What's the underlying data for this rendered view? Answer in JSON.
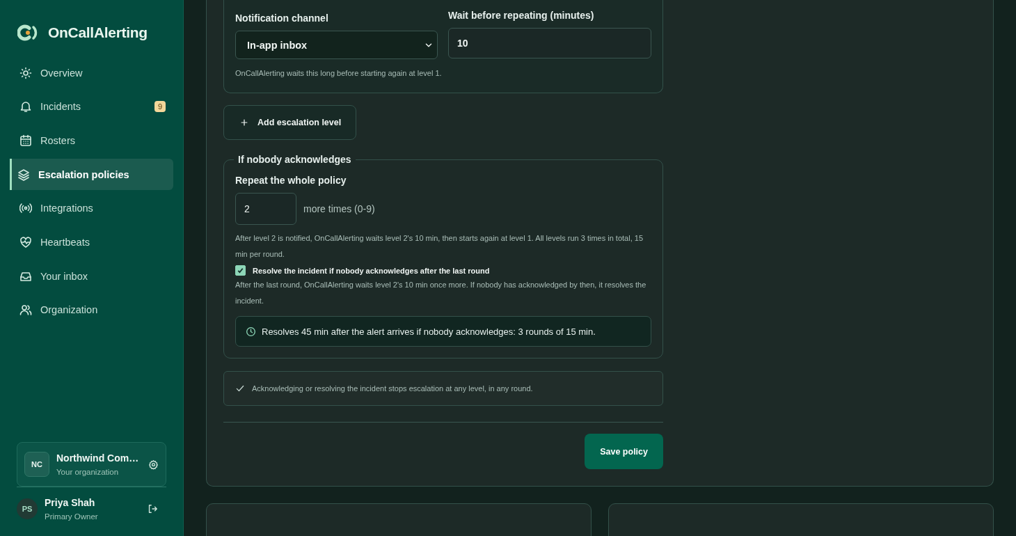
{
  "brand": {
    "name": "OnCallAlerting"
  },
  "nav": [
    {
      "label": "Overview",
      "selected": false
    },
    {
      "label": "Incidents",
      "selected": false,
      "badge": "9"
    },
    {
      "label": "Rosters",
      "selected": false
    },
    {
      "label": "Escalation policies",
      "selected": true
    },
    {
      "label": "Integrations",
      "selected": false
    },
    {
      "label": "Heartbeats",
      "selected": false
    },
    {
      "label": "Your inbox",
      "selected": false
    },
    {
      "label": "Organization",
      "selected": false
    }
  ],
  "organization": {
    "initials": "NC",
    "name": "Northwind Com…",
    "subtitle": "Your organization"
  },
  "user": {
    "initials": "PS",
    "name": "Priya Shah",
    "role": "Primary Owner"
  },
  "level_card": {
    "channel_label": "Notification channel",
    "channel_value": "In-app inbox",
    "wait_label": "Wait before repeating (minutes)",
    "wait_value": "10",
    "hint": "OnCallAlerting waits this long before starting again at level 1."
  },
  "add_level_button": "Add escalation level",
  "no_ack": {
    "legend": "If nobody acknowledges",
    "repeat_label": "Repeat the whole policy",
    "repeat_value": "2",
    "repeat_suffix": "more times (0-9)",
    "repeat_hint": "After level 2 is notified, OnCallAlerting waits level 2's 10 min, then starts again at level 1. All levels run 3 times in total, 15 min per round.",
    "resolve": {
      "label": "Resolve the incident if nobody acknowledges after the last round",
      "checked": true
    },
    "resolve_hint": "After the last round, OnCallAlerting waits level 2's 10 min once more. If nobody has acknowledged by then, it resolves the incident.",
    "summary": "Resolves 45 min after the alert arrives if nobody acknowledges: 3 rounds of 15 min."
  },
  "note": "Acknowledging or resolving the incident stops escalation at any level, in any round.",
  "save_button": "Save policy"
}
